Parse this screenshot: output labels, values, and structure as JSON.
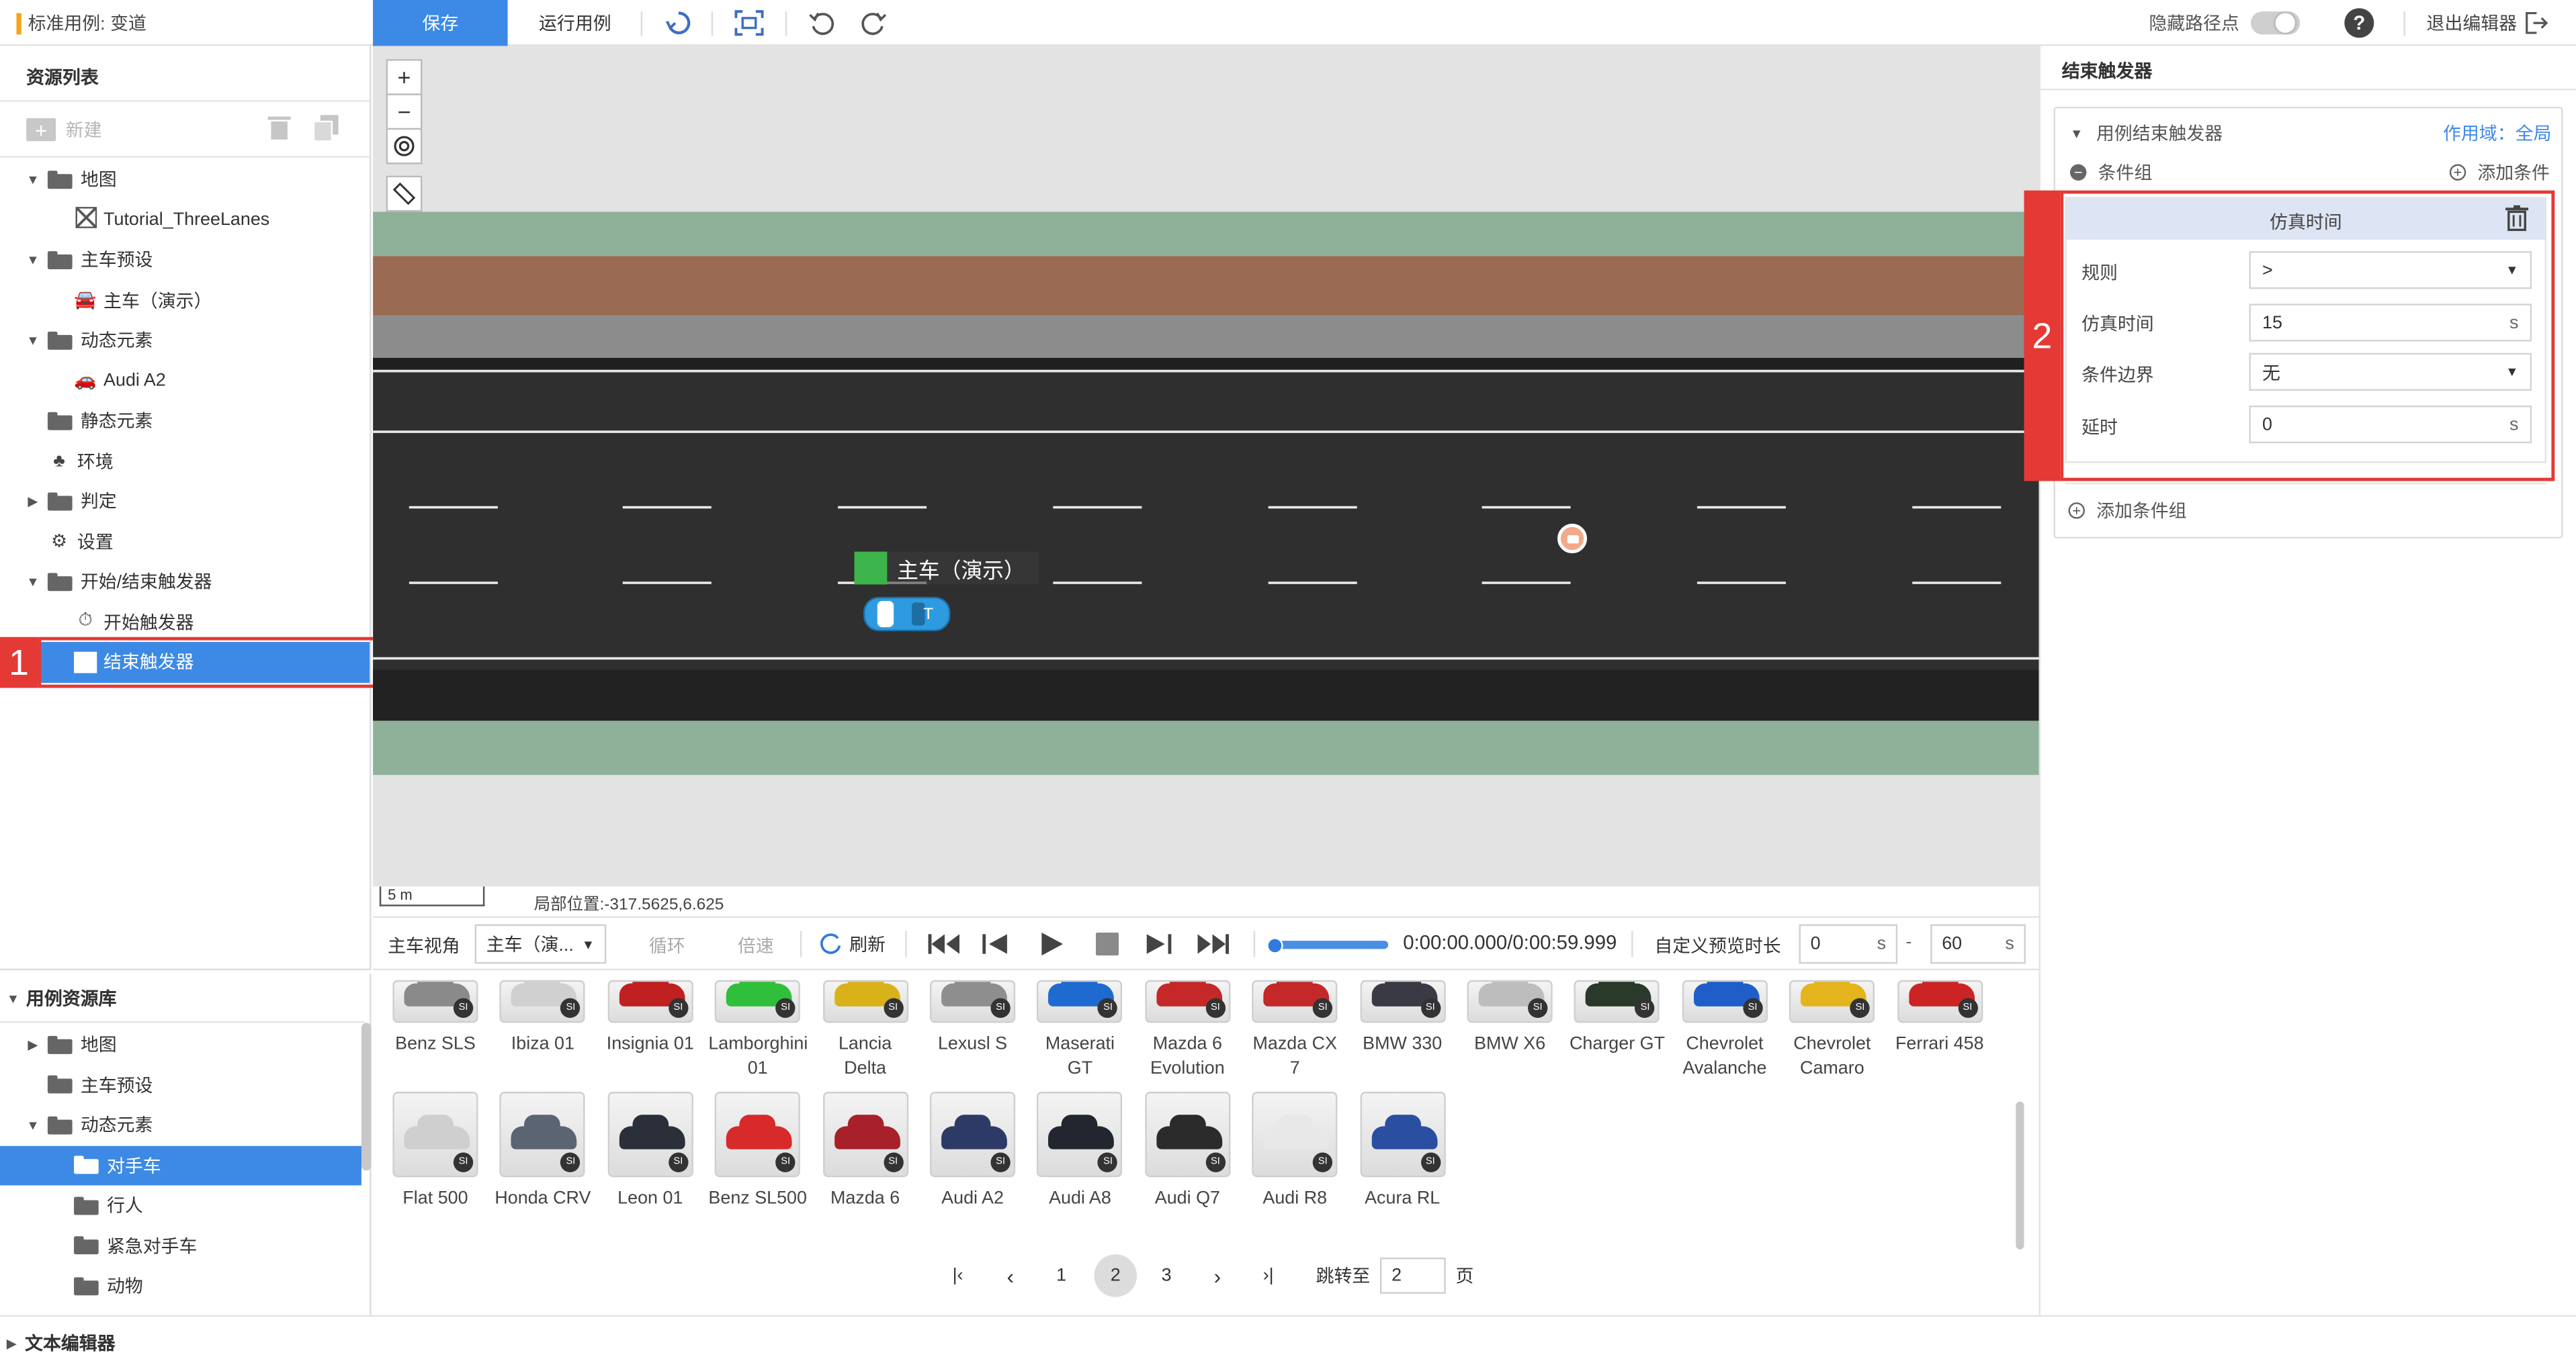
{
  "header": {
    "case_title": "标准用例: 变道",
    "save_label": "保存",
    "run_label": "运行用例",
    "hide_waypoints_label": "隐藏路径点",
    "help_label": "?",
    "exit_label": "退出编辑器"
  },
  "resource_list": {
    "title": "资源列表",
    "new_label": "新建",
    "items": [
      {
        "label": "地图"
      },
      {
        "label": "Tutorial_ThreeLanes"
      },
      {
        "label": "主车预设"
      },
      {
        "label": "主车（演示）"
      },
      {
        "label": "动态元素"
      },
      {
        "label": "Audi A2"
      },
      {
        "label": "静态元素"
      },
      {
        "label": "环境"
      },
      {
        "label": "判定"
      },
      {
        "label": "设置"
      },
      {
        "label": "开始/结束触发器"
      },
      {
        "label": "开始触发器"
      },
      {
        "label": "结束触发器"
      }
    ]
  },
  "map": {
    "ego_label": "主车（演示）",
    "scale_label": "5 m",
    "position_label": "局部位置:-317.5625,6.625",
    "colors": {
      "grass": "#8fb19a",
      "dirt": "#9a6a52",
      "shoulder": "#8c8c8c",
      "asphalt": "#2f2f2f",
      "background": "#e3e3e3"
    }
  },
  "controls": {
    "view_label": "主车视角",
    "view_select": "主车（演...",
    "loop_label": "循环",
    "speed_label": "倍速",
    "refresh_label": "刷新",
    "time_display": "0:00:00.000/0:00:59.999",
    "preview_label": "自定义预览时长",
    "preview_start": "0",
    "preview_end": "60",
    "unit_s": "s",
    "range_sep": "-",
    "progress": 0
  },
  "library": {
    "title": "用例资源库",
    "items": [
      {
        "label": "地图"
      },
      {
        "label": "主车预设"
      },
      {
        "label": "动态元素"
      },
      {
        "label": "对手车"
      },
      {
        "label": "行人"
      },
      {
        "label": "紧急对手车"
      },
      {
        "label": "动物"
      }
    ],
    "row1": [
      {
        "name": "Benz SLS",
        "color": "#8a8a8a"
      },
      {
        "name": "Ibiza 01",
        "color": "#d0d0d0"
      },
      {
        "name": "Insignia 01",
        "color": "#c02020"
      },
      {
        "name": "Lamborghini 01",
        "color": "#2fbf3a"
      },
      {
        "name": "Lancia Delta",
        "color": "#d9b21a"
      },
      {
        "name": "Lexusl S",
        "color": "#8e8e8e"
      },
      {
        "name": "Maserati GT",
        "color": "#1f6ad1"
      },
      {
        "name": "Mazda 6 Evolution",
        "color": "#c42828"
      },
      {
        "name": "Mazda CX 7",
        "color": "#c42828"
      },
      {
        "name": "BMW 330",
        "color": "#3a3a45"
      },
      {
        "name": "BMW X6",
        "color": "#bdbdbd"
      },
      {
        "name": "Charger GT",
        "color": "#2a3a2a"
      },
      {
        "name": "Chevrolet Avalanche",
        "color": "#1f5ec9"
      },
      {
        "name": "Chevrolet Camaro",
        "color": "#e3b41c"
      },
      {
        "name": "Ferrari 458",
        "color": "#cc2424"
      }
    ],
    "row2": [
      {
        "name": "Flat 500",
        "color": "#cfcfcf"
      },
      {
        "name": "Honda CRV",
        "color": "#5a6473"
      },
      {
        "name": "Leon 01",
        "color": "#2b2f3a"
      },
      {
        "name": "Benz SL500",
        "color": "#d82a2a"
      },
      {
        "name": "Mazda 6",
        "color": "#a8202a"
      },
      {
        "name": "Audi A2",
        "color": "#2e3a66"
      },
      {
        "name": "Audi A8",
        "color": "#22262e"
      },
      {
        "name": "Audi Q7",
        "color": "#2b2b2b"
      },
      {
        "name": "Audi R8",
        "color": "#e8e8e8"
      },
      {
        "name": "Acura RL",
        "color": "#2a4fa0"
      }
    ],
    "badge": "SI",
    "pages": [
      "1",
      "2",
      "3"
    ],
    "current_page": "2",
    "jump_label": "跳转至",
    "jump_value": "2",
    "page_suffix": "页"
  },
  "trigger_panel": {
    "title": "结束触发器",
    "section_label": "用例结束触发器",
    "scope_label": "作用域：全局",
    "condition_group_label": "条件组",
    "add_condition_label": "添加条件",
    "condition_title": "仿真时间",
    "fields": [
      {
        "label": "规则",
        "value": ">",
        "kind": "select"
      },
      {
        "label": "仿真时间",
        "value": "15",
        "unit": "s",
        "kind": "input"
      },
      {
        "label": "条件边界",
        "value": "无",
        "kind": "select"
      },
      {
        "label": "延时",
        "value": "0",
        "unit": "s",
        "kind": "input"
      }
    ],
    "add_group_label": "添加条件组"
  },
  "annotations": {
    "one": "1",
    "two": "2"
  },
  "footer": {
    "text_editor_label": "文本编辑器"
  }
}
